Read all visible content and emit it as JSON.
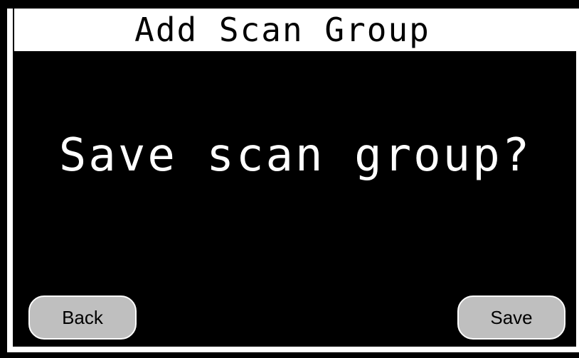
{
  "header": {
    "title": "Add Scan Group"
  },
  "dialog": {
    "prompt": "Save scan group?"
  },
  "buttons": {
    "back_label": "Back",
    "save_label": "Save"
  },
  "colors": {
    "background": "#000000",
    "header_background": "#ffffff",
    "button_fill": "#bfbfbf",
    "text_light": "#ffffff",
    "text_dark": "#000000"
  }
}
